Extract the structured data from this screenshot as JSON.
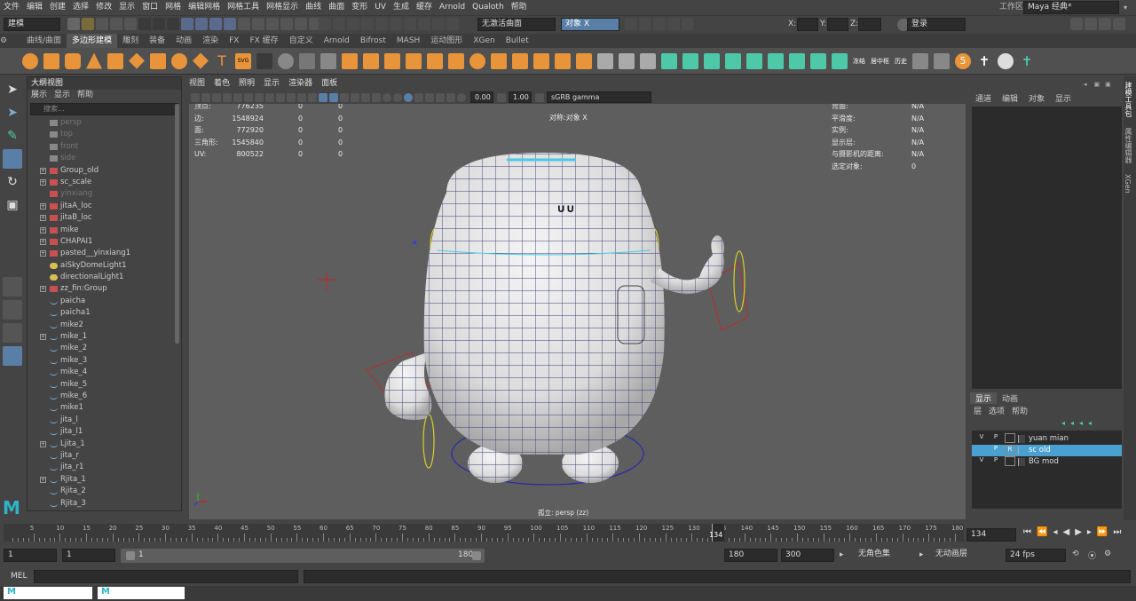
{
  "menubar": {
    "items": [
      "文件",
      "编辑",
      "创建",
      "选择",
      "修改",
      "显示",
      "窗口",
      "网格",
      "编辑网格",
      "网格工具",
      "网格显示",
      "曲线",
      "曲面",
      "变形",
      "UV",
      "生成",
      "缓存",
      "Arnold",
      "Qualoth",
      "帮助"
    ],
    "workspace_label": "工作区:",
    "workspace_value": "Maya 经典*"
  },
  "statusline": {
    "mode": "建模",
    "live_surface": "无激活曲面",
    "symmetry": "对象 X",
    "x_label": "X:",
    "y_label": "Y:",
    "z_label": "Z:",
    "login": "登录"
  },
  "shelf_tabs": [
    "曲线/曲面",
    "多边形建模",
    "雕刻",
    "装备",
    "动画",
    "渲染",
    "FX",
    "FX 缓存",
    "自定义",
    "Arnold",
    "Bifrost",
    "MASH",
    "运动图形",
    "XGen",
    "Bullet"
  ],
  "shelf_active": "多边形建模",
  "shelf_text_icons": {
    "freeze": "冻结",
    "center": "居中枢",
    "history": "历史",
    "five": "5"
  },
  "outliner": {
    "title": "大纲视图",
    "menu": [
      "展示",
      "显示",
      "帮助"
    ],
    "search_placeholder": "搜索...",
    "items": [
      {
        "label": "persp",
        "expand": false,
        "dim": true,
        "icon": "camera-icon"
      },
      {
        "label": "top",
        "expand": false,
        "dim": true,
        "icon": "camera-icon"
      },
      {
        "label": "front",
        "expand": false,
        "dim": true,
        "icon": "camera-icon"
      },
      {
        "label": "side",
        "expand": false,
        "dim": true,
        "icon": "camera-icon"
      },
      {
        "label": "Group_old",
        "expand": true,
        "dim": false,
        "icon": "group-icon"
      },
      {
        "label": "sc_scale",
        "expand": true,
        "dim": false,
        "icon": "group-icon"
      },
      {
        "label": "yinxiang",
        "expand": false,
        "dim": true,
        "icon": "group-icon"
      },
      {
        "label": "jitaA_loc",
        "expand": true,
        "dim": false,
        "icon": "group-icon"
      },
      {
        "label": "jitaB_loc",
        "expand": true,
        "dim": false,
        "icon": "group-icon"
      },
      {
        "label": "mike",
        "expand": true,
        "dim": false,
        "icon": "group-icon"
      },
      {
        "label": "CHAPAI1",
        "expand": true,
        "dim": false,
        "icon": "group-icon"
      },
      {
        "label": "pasted__yinxiang1",
        "expand": true,
        "dim": false,
        "icon": "group-icon"
      },
      {
        "label": "aiSkyDomeLight1",
        "expand": false,
        "dim": false,
        "icon": "light-icon"
      },
      {
        "label": "directionalLight1",
        "expand": false,
        "dim": false,
        "icon": "light-icon"
      },
      {
        "label": "zz_fin:Group",
        "expand": true,
        "dim": false,
        "icon": "group-icon"
      },
      {
        "label": "paicha",
        "expand": false,
        "dim": false,
        "icon": "curve-icon"
      },
      {
        "label": "paicha1",
        "expand": false,
        "dim": false,
        "icon": "curve-icon"
      },
      {
        "label": "mike2",
        "expand": false,
        "dim": false,
        "icon": "curve-icon"
      },
      {
        "label": "mike_1",
        "expand": true,
        "dim": false,
        "icon": "curve-icon"
      },
      {
        "label": "mike_2",
        "expand": false,
        "dim": false,
        "icon": "curve-icon"
      },
      {
        "label": "mike_3",
        "expand": false,
        "dim": false,
        "icon": "curve-icon"
      },
      {
        "label": "mike_4",
        "expand": false,
        "dim": false,
        "icon": "curve-icon"
      },
      {
        "label": "mike_5",
        "expand": false,
        "dim": false,
        "icon": "curve-icon"
      },
      {
        "label": "mike_6",
        "expand": false,
        "dim": false,
        "icon": "curve-icon"
      },
      {
        "label": "mike1",
        "expand": false,
        "dim": false,
        "icon": "curve-icon"
      },
      {
        "label": "jita_l",
        "expand": false,
        "dim": false,
        "icon": "curve-icon"
      },
      {
        "label": "jita_l1",
        "expand": false,
        "dim": false,
        "icon": "curve-icon"
      },
      {
        "label": "Ljita_1",
        "expand": true,
        "dim": false,
        "icon": "curve-icon"
      },
      {
        "label": "jita_r",
        "expand": false,
        "dim": false,
        "icon": "curve-icon"
      },
      {
        "label": "jita_r1",
        "expand": false,
        "dim": false,
        "icon": "curve-icon"
      },
      {
        "label": "Rjita_1",
        "expand": true,
        "dim": false,
        "icon": "curve-icon"
      },
      {
        "label": "Rjita_2",
        "expand": false,
        "dim": false,
        "icon": "curve-icon"
      },
      {
        "label": "Rjita_3",
        "expand": false,
        "dim": false,
        "icon": "curve-icon"
      }
    ]
  },
  "viewport": {
    "menu": [
      "视图",
      "着色",
      "照明",
      "显示",
      "渲染器",
      "面板"
    ],
    "exposure": "0.00",
    "gamma": "1.00",
    "color_space": "sGRB gamma",
    "hud_left": [
      {
        "label": "顶点:",
        "v1": "776235",
        "v2": "0",
        "v3": "0"
      },
      {
        "label": "边:",
        "v1": "1548924",
        "v2": "0",
        "v3": "0"
      },
      {
        "label": "面:",
        "v1": "772920",
        "v2": "0",
        "v3": "0"
      },
      {
        "label": "三角形:",
        "v1": "1545840",
        "v2": "0",
        "v3": "0"
      },
      {
        "label": "UV:",
        "v1": "800522",
        "v2": "0",
        "v3": "0"
      }
    ],
    "hud_center": "对称:对象 X",
    "hud_right": [
      {
        "label": "背面:",
        "value": "N/A"
      },
      {
        "label": "平滑度:",
        "value": "N/A"
      },
      {
        "label": "实例:",
        "value": "N/A"
      },
      {
        "label": "显示层:",
        "value": "N/A"
      },
      {
        "label": "与摄影机的距离:",
        "value": "N/A"
      },
      {
        "label": "选定对象:",
        "value": "0"
      }
    ],
    "camera_label": "孤立: persp (zz)"
  },
  "channelbox": {
    "menu": [
      "通道",
      "编辑",
      "对象",
      "显示"
    ],
    "layer_tabs": [
      "显示",
      "动画"
    ],
    "layer_menu": [
      "层",
      "选项",
      "帮助"
    ],
    "layers": [
      {
        "v": "V",
        "p": "P",
        "r": "",
        "name": "yuan mian",
        "color": "#444444",
        "selected": false
      },
      {
        "v": "",
        "p": "P",
        "r": "R",
        "name": "sc old",
        "color": "#4aa0d0",
        "selected": true
      },
      {
        "v": "V",
        "p": "P",
        "r": "",
        "name": "BG mod",
        "color": "#444444",
        "selected": false
      }
    ]
  },
  "side_tabs": [
    "建模工具包",
    "属性编辑器",
    "XGen"
  ],
  "timeline": {
    "start": 1,
    "end": 180,
    "current": 134,
    "current_label": "134",
    "tick_labels": [
      "5",
      "10",
      "15",
      "20",
      "25",
      "30",
      "35",
      "40",
      "45",
      "50",
      "55",
      "60",
      "65",
      "70",
      "75",
      "80",
      "85",
      "90",
      "95",
      "100",
      "105",
      "110",
      "115",
      "120",
      "125",
      "130",
      "135",
      "140",
      "145",
      "150",
      "155",
      "160",
      "165",
      "170",
      "175",
      "180"
    ]
  },
  "range": {
    "start_field": "1",
    "anim_start": "1",
    "slider_start": "1",
    "slider_end": "180",
    "anim_end": "180",
    "end_field": "300",
    "char_set": "无角色集",
    "anim_layer": "无动画层",
    "fps": "24 fps"
  },
  "cmdline": {
    "label": "MEL"
  },
  "colors": {
    "accent": "#4aa0d0",
    "menu_bg": "#444444",
    "viewport_bg": "#5e5e5e",
    "icon_orange": "#e8943a",
    "icon_green": "#4ec9a8"
  }
}
